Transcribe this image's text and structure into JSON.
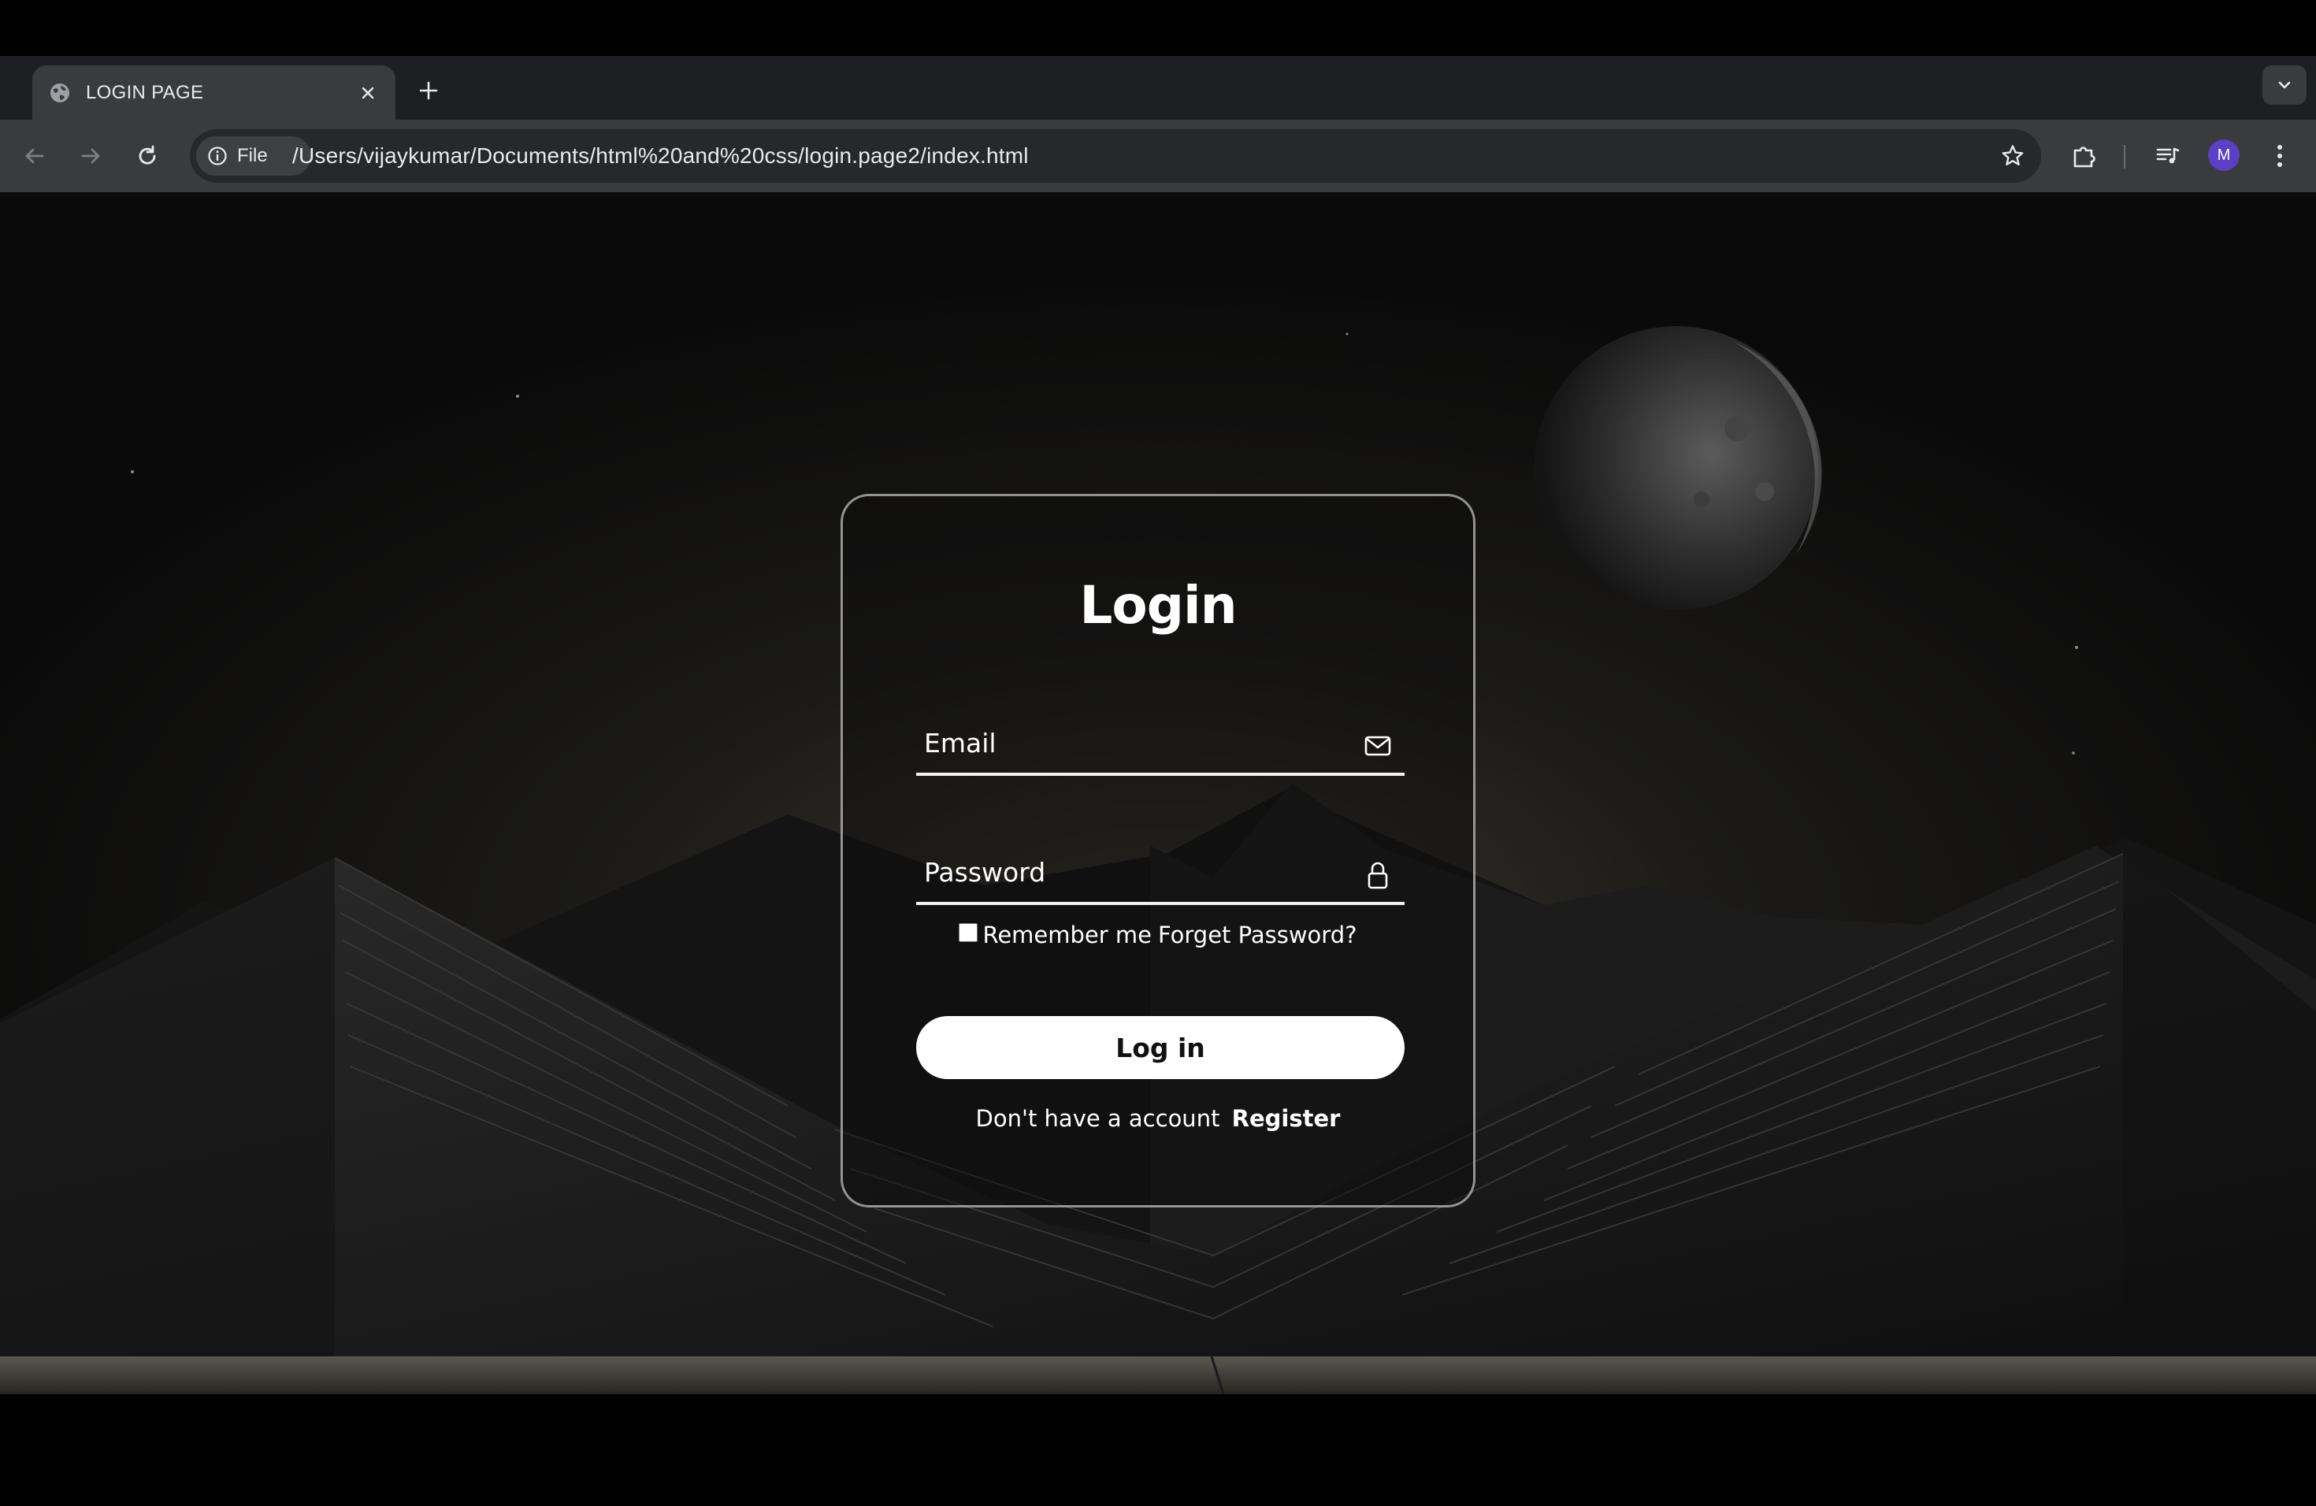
{
  "browser": {
    "tab": {
      "title": "LOGIN PAGE",
      "favicon": "globe-icon"
    },
    "address_bar": {
      "chip_label": "File",
      "url": "/Users/vijaykumar/Documents/html%20and%20css/login.page2/index.html"
    },
    "profile_initial": "M",
    "colors": {
      "chrome_dark": "#1e1f22",
      "chrome_toolbar": "#3a3b3e",
      "avatar": "#5b3fc4"
    }
  },
  "login": {
    "title": "Login",
    "email_placeholder": "Email",
    "password_placeholder": "Password",
    "remember_label": "Remember me",
    "forget_label": "Forget Password?",
    "remember_checked": false,
    "submit_label": "Log in",
    "register_prompt": "Don't have a account",
    "register_label": "Register"
  }
}
